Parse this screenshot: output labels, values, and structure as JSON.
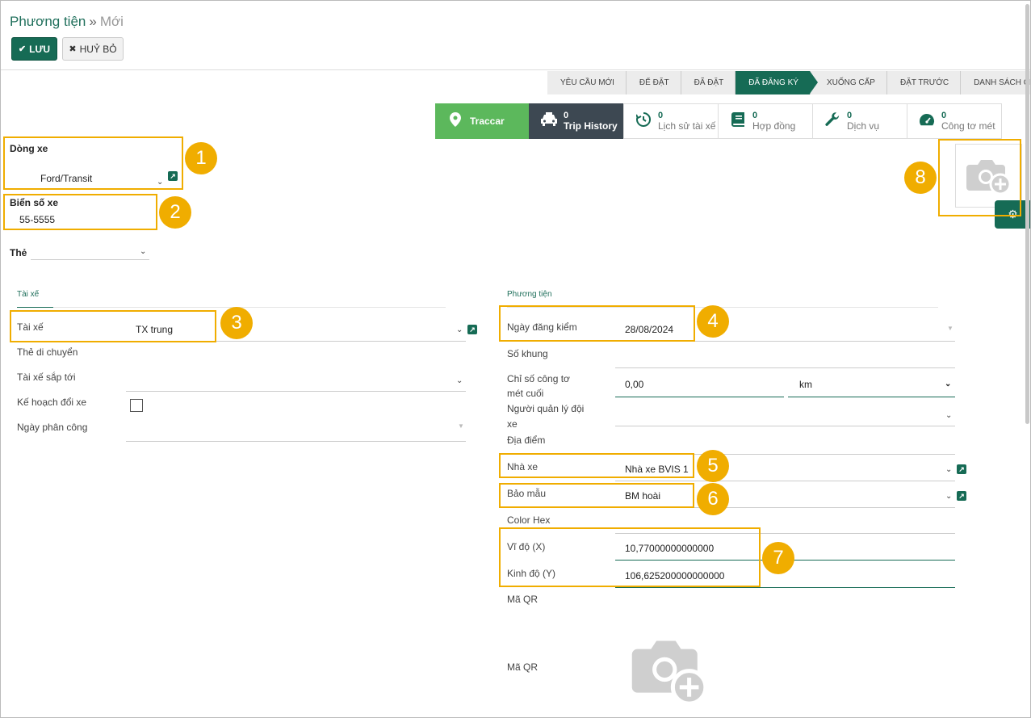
{
  "breadcrumb": {
    "root": "Phương tiện",
    "current": "Mới"
  },
  "actions": {
    "save": "LƯU",
    "cancel": "HUỶ BỎ"
  },
  "statusbar": [
    "YÊU CẦU MỚI",
    "ĐỂ ĐẶT",
    "ĐÃ ĐẶT",
    "ĐÃ ĐĂNG KÝ",
    "XUỐNG CẤP",
    "ĐẶT TRƯỚC",
    "DANH SÁCH CHỜ"
  ],
  "smart_buttons": {
    "traccar": "Traccar",
    "trip_history": {
      "count": "0",
      "label": "Trip History"
    },
    "driver_history": {
      "count": "0",
      "label": "Lịch sử tài xế"
    },
    "contracts": {
      "count": "0",
      "label": "Hợp đồng"
    },
    "services": {
      "count": "0",
      "label": "Dịch vụ"
    },
    "odometer": {
      "count": "0",
      "label": "Công tơ mét"
    }
  },
  "form": {
    "model": {
      "label": "Dòng xe",
      "value": "Ford/Transit"
    },
    "plate": {
      "label": "Biển số xe",
      "value": "55-5555"
    },
    "tags": {
      "label": "Thẻ",
      "value": ""
    },
    "tab_driver": "Tài xế",
    "tab_vehicle": "Phương tiện",
    "driver": {
      "label": "Tài xế",
      "value": "TX trung"
    },
    "mobility_card": {
      "label": "Thẻ di chuyển"
    },
    "future_driver": {
      "label": "Tài xế sắp tới"
    },
    "plan_to_change": {
      "label": "Kế hoạch đổi xe"
    },
    "assign_date": {
      "label": "Ngày phân công"
    },
    "inspection_date": {
      "label": "Ngày đăng kiểm",
      "value": "28/08/2024"
    },
    "chassis": {
      "label": "Số khung"
    },
    "odometer_last": {
      "label_line1": "Chỉ số công tơ",
      "label_line2": "mét cuối",
      "value": "0,00",
      "unit": "km"
    },
    "fleet_manager": {
      "label_line1": "Người quản lý đội",
      "label_line2": "xe"
    },
    "location": {
      "label": "Địa điểm"
    },
    "garage": {
      "label": "Nhà xe",
      "value": "Nhà xe BVIS 1"
    },
    "nanny": {
      "label": "Bảo mẫu",
      "value": "BM hoài"
    },
    "color_hex": {
      "label": "Color Hex"
    },
    "lat": {
      "label": "Vĩ độ (X)",
      "value": "10,77000000000000"
    },
    "lng": {
      "label": "Kinh độ (Y)",
      "value": "106,625200000000000"
    },
    "qr_code": {
      "label": "Mã QR"
    },
    "qr_image": {
      "label": "Mã QR"
    }
  },
  "callouts": [
    "1",
    "2",
    "3",
    "4",
    "5",
    "6",
    "7",
    "8"
  ],
  "colors": {
    "primary": "#166b55",
    "traccar": "#5cb85c",
    "highlight": "#f0ad00"
  }
}
